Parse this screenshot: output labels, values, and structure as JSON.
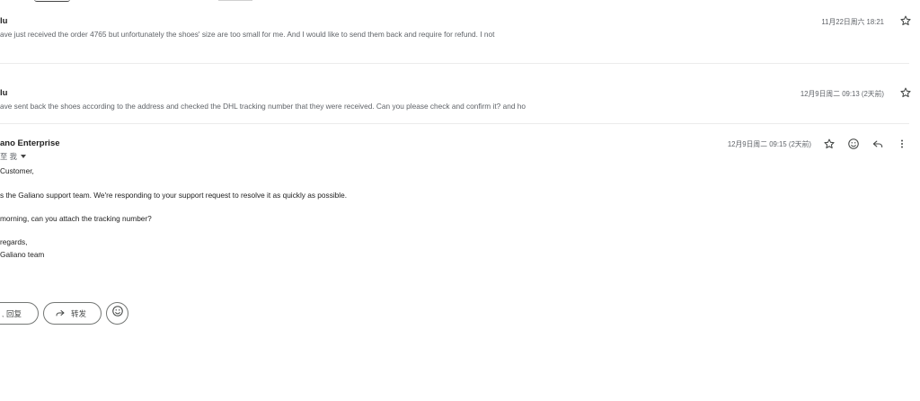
{
  "thread": [
    {
      "sender": "lu",
      "snippet": "ave just received the order 4765 but unfortunately the shoes' size are too small for me. And I would like to send them back and require for refund. I not",
      "date": "11月22日周六 18:21",
      "starred": false
    },
    {
      "sender": "lu",
      "snippet": "ave sent back the shoes according to the address and checked the DHL tracking number that they were received. Can you please check and confirm it? and ho",
      "date": "12月9日周二 09:13 (2天前)",
      "starred": false
    }
  ],
  "open_message": {
    "sender": "ano Enterprise",
    "recipient": "至 我",
    "date": "12月9日周二 09:15 (2天前)",
    "body": [
      "Customer,",
      "s the Galiano support team. We're responding to your support request to resolve it as quickly as possible.",
      " morning, can you attach the tracking number?",
      "regards,",
      "Galiano team"
    ]
  },
  "actions": {
    "reply_label": "回复",
    "forward_label": "转发"
  },
  "icons": {
    "star": "star-icon",
    "emoji": "emoji-icon",
    "reply": "reply-icon",
    "more": "more-vert-icon",
    "forward": "forward-icon"
  },
  "colors": {
    "text_primary": "#1f1f1f",
    "text_secondary": "#5f6368",
    "border": "#747775",
    "divider": "#ebebeb"
  }
}
